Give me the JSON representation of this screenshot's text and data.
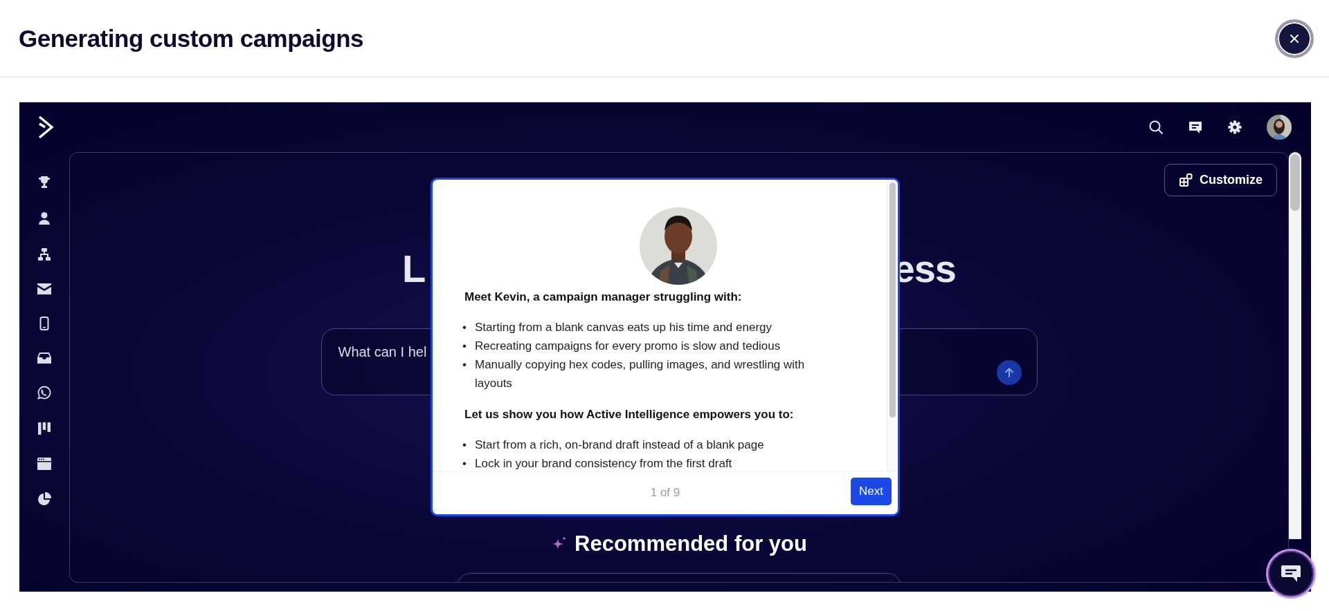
{
  "header": {
    "title": "Generating custom campaigns"
  },
  "app": {
    "customize_button": "Customize",
    "heading_fragments": [
      "L",
      "ess"
    ],
    "prompt": {
      "placeholder": "What can I hel"
    },
    "recommended": {
      "title": "Recommended for you"
    }
  },
  "tour": {
    "intro": "Meet Kevin, a campaign manager struggling with:",
    "pains": [
      {
        "bullet": "•",
        "text": "Starting from a blank canvas eats up his time and energy"
      },
      {
        "bullet": "•",
        "text": "Recreating campaigns for every promo is slow and tedious"
      },
      {
        "bullet": "•",
        "text": "Manually copying hex codes, pulling images, and wrestling with layouts"
      }
    ],
    "benefits_heading": "Let us show you how Active Intelligence empowers you to:",
    "benefits": [
      {
        "bullet": "•",
        "text": "Start from a rich, on-brand draft instead of a blank page"
      },
      {
        "bullet": "•",
        "text": "Lock in your brand consistency from the first draft"
      }
    ],
    "progress": "1 of 9",
    "next_button": "Next"
  }
}
